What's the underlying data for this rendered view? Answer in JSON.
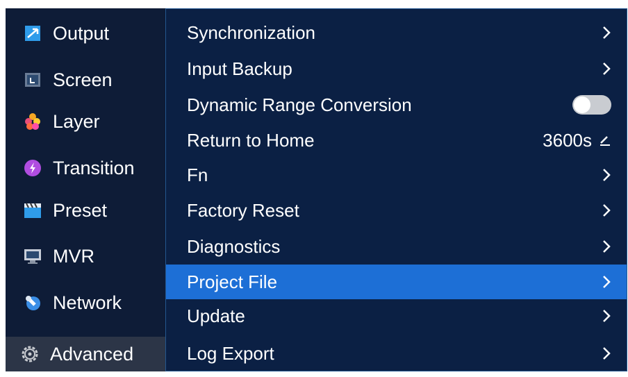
{
  "sidebar": {
    "items": [
      {
        "label": "Output",
        "icon": "output-icon"
      },
      {
        "label": "Screen",
        "icon": "screen-icon"
      },
      {
        "label": "Layer",
        "icon": "layer-icon"
      },
      {
        "label": "Transition",
        "icon": "transition-icon"
      },
      {
        "label": "Preset",
        "icon": "preset-icon"
      },
      {
        "label": "MVR",
        "icon": "mvr-icon"
      },
      {
        "label": "Network",
        "icon": "network-icon"
      },
      {
        "label": "Advanced",
        "icon": "gear-icon",
        "active": true
      }
    ]
  },
  "menu": {
    "items": [
      {
        "label": "Synchronization",
        "control": "chevron"
      },
      {
        "label": "Input Backup",
        "control": "chevron"
      },
      {
        "label": "Dynamic Range Conversion",
        "control": "toggle",
        "state": "off"
      },
      {
        "label": "Return to Home",
        "control": "value",
        "value": "3600s"
      },
      {
        "label": "Fn",
        "control": "chevron"
      },
      {
        "label": "Factory Reset",
        "control": "chevron"
      },
      {
        "label": "Diagnostics",
        "control": "chevron"
      },
      {
        "label": "Project File",
        "control": "chevron",
        "selected": true
      },
      {
        "label": "Update",
        "control": "chevron"
      },
      {
        "label": "Log Export",
        "control": "chevron"
      }
    ]
  },
  "colors": {
    "background": "#0d1b36",
    "panel": "#0b2044",
    "selected": "#1d6fd6",
    "active_sidebar": "#2c3547"
  }
}
